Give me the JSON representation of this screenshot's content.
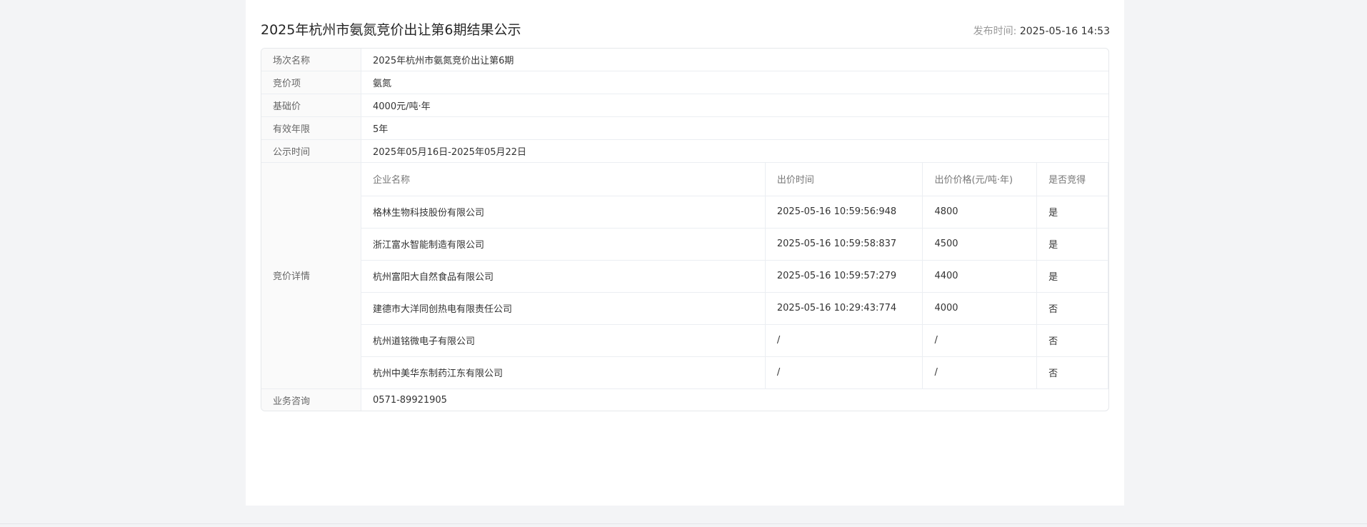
{
  "header": {
    "title": "2025年杭州市氨氮竞价出让第6期结果公示",
    "publish_label": "发布时间:",
    "publish_time": "2025-05-16 14:53"
  },
  "info": {
    "session_label": "场次名称",
    "session_value": "2025年杭州市氨氮竞价出让第6期",
    "item_label": "竞价项",
    "item_value": "氨氮",
    "base_price_label": "基础价",
    "base_price_value": "4000元/吨·年",
    "validity_label": "有效年限",
    "validity_value": "5年",
    "notice_time_label": "公示时间",
    "notice_time_value": "2025年05月16日-2025年05月22日",
    "detail_label": "竞价详情",
    "consult_label": "业务咨询",
    "consult_value": "0571-89921905"
  },
  "bids": {
    "headers": [
      "企业名称",
      "出价时间",
      "出价价格(元/吨·年)",
      "是否竞得"
    ],
    "rows": [
      {
        "company": "格林生物科技股份有限公司",
        "time": "2025-05-16 10:59:56:948",
        "price": "4800",
        "won": "是"
      },
      {
        "company": "浙江富水智能制造有限公司",
        "time": "2025-05-16 10:59:58:837",
        "price": "4500",
        "won": "是"
      },
      {
        "company": "杭州富阳大自然食品有限公司",
        "time": "2025-05-16 10:59:57:279",
        "price": "4400",
        "won": "是"
      },
      {
        "company": "建德市大洋同创热电有限责任公司",
        "time": "2025-05-16 10:29:43:774",
        "price": "4000",
        "won": "否"
      },
      {
        "company": "杭州道铭微电子有限公司",
        "time": "/",
        "price": "/",
        "won": "否"
      },
      {
        "company": "杭州中美华东制药江东有限公司",
        "time": "/",
        "price": "/",
        "won": "否"
      }
    ]
  }
}
